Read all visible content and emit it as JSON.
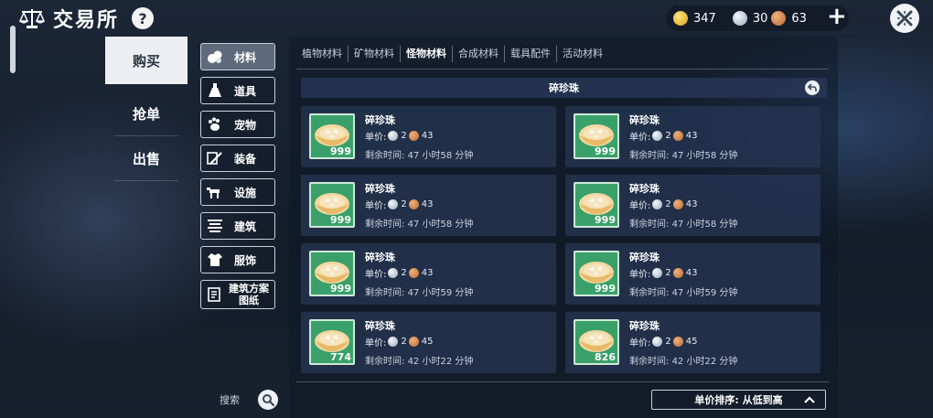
{
  "header": {
    "title": "交易所",
    "help_label": "?"
  },
  "currency": {
    "gold": "347",
    "silver": "30",
    "copper": "63",
    "add_label": "+"
  },
  "colors": {
    "gold": "#e0b12a",
    "silver": "#c7d0da",
    "copper": "#c47a42",
    "thumb_bg": "#3aa06a",
    "panel": "#243450"
  },
  "modes": [
    {
      "label": "购买",
      "active": true
    },
    {
      "label": "抢单",
      "active": false
    },
    {
      "label": "出售",
      "active": false
    }
  ],
  "categories": [
    {
      "label": "材料",
      "icon": "materials-icon",
      "active": true
    },
    {
      "label": "道具",
      "icon": "potion-icon",
      "active": false
    },
    {
      "label": "宠物",
      "icon": "paw-icon",
      "active": false
    },
    {
      "label": "装备",
      "icon": "sword-icon",
      "active": false
    },
    {
      "label": "设施",
      "icon": "mount-icon",
      "active": false
    },
    {
      "label": "建筑",
      "icon": "building-icon",
      "active": false
    },
    {
      "label": "服饰",
      "icon": "clothing-icon",
      "active": false
    },
    {
      "label": "建筑方案",
      "label2": "图纸",
      "icon": "blueprint-icon",
      "active": false
    }
  ],
  "search": {
    "label": "搜索"
  },
  "subtabs": [
    {
      "label": "植物材料",
      "active": false
    },
    {
      "label": "矿物材料",
      "active": false
    },
    {
      "label": "怪物材料",
      "active": true
    },
    {
      "label": "合成材料",
      "active": false
    },
    {
      "label": "载具配件",
      "active": false
    },
    {
      "label": "活动材料",
      "active": false
    }
  ],
  "item": {
    "name": "碎珍珠"
  },
  "labels": {
    "price": "单价:",
    "time_prefix": "剩余时间:"
  },
  "listings": [
    {
      "name": "碎珍珠",
      "qty": "999",
      "silver": "2",
      "copper": "43",
      "time": "47 小时58 分钟"
    },
    {
      "name": "碎珍珠",
      "qty": "999",
      "silver": "2",
      "copper": "43",
      "time": "47 小时58 分钟"
    },
    {
      "name": "碎珍珠",
      "qty": "999",
      "silver": "2",
      "copper": "43",
      "time": "47 小时58 分钟"
    },
    {
      "name": "碎珍珠",
      "qty": "999",
      "silver": "2",
      "copper": "43",
      "time": "47 小时58 分钟"
    },
    {
      "name": "碎珍珠",
      "qty": "999",
      "silver": "2",
      "copper": "43",
      "time": "47 小时59 分钟"
    },
    {
      "name": "碎珍珠",
      "qty": "999",
      "silver": "2",
      "copper": "43",
      "time": "47 小时59 分钟"
    },
    {
      "name": "碎珍珠",
      "qty": "774",
      "silver": "2",
      "copper": "45",
      "time": "42 小时22 分钟"
    },
    {
      "name": "碎珍珠",
      "qty": "826",
      "silver": "2",
      "copper": "45",
      "time": "42 小时22 分钟"
    }
  ],
  "sort": {
    "label": "单价排序: 从低到高"
  }
}
